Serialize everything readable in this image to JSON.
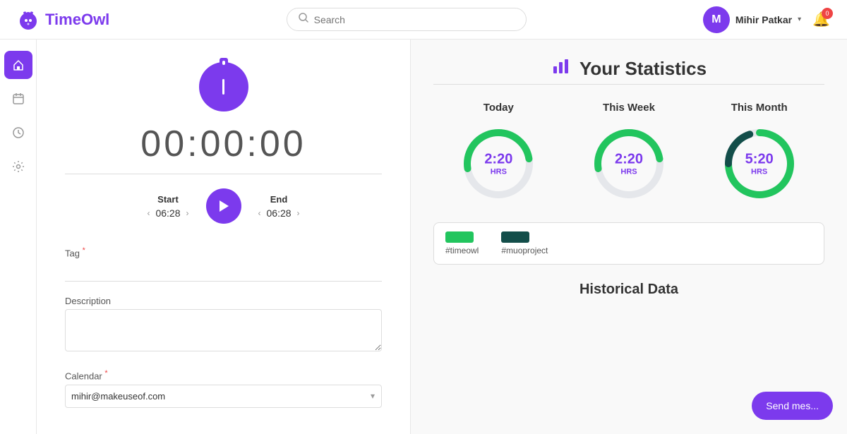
{
  "brand": {
    "name": "TimeOwl"
  },
  "navbar": {
    "search_placeholder": "Search",
    "user": {
      "initial": "M",
      "name": "Mihir Patkar"
    },
    "notification_count": "0"
  },
  "sidebar": {
    "items": [
      {
        "icon": "home",
        "label": "Home",
        "active": true
      },
      {
        "icon": "calendar",
        "label": "Calendar",
        "active": false
      },
      {
        "icon": "history",
        "label": "History",
        "active": false
      },
      {
        "icon": "settings",
        "label": "Settings",
        "active": false
      }
    ]
  },
  "timer": {
    "display": "00:00:00",
    "start_label": "Start",
    "start_time": "06:28",
    "end_label": "End",
    "end_time": "06:28"
  },
  "form": {
    "tag_label": "Tag",
    "tag_required": true,
    "description_label": "Description",
    "calendar_label": "Calendar",
    "calendar_required": true,
    "calendar_value": "mihir@makeuseof.com"
  },
  "statistics": {
    "title": "Your Statistics",
    "periods": [
      {
        "label": "Today",
        "time": "2:20",
        "unit": "HRS",
        "progress": 45
      },
      {
        "label": "This Week",
        "time": "2:20",
        "unit": "HRS",
        "progress": 45
      },
      {
        "label": "This Month",
        "time": "5:20",
        "unit": "HRS",
        "progress": 75
      }
    ],
    "legend": [
      {
        "color": "#22c55e",
        "label": "#timeowl"
      },
      {
        "color": "#134e4a",
        "label": "#muoproject"
      }
    ],
    "historical_title": "Historical Data"
  },
  "send_message": {
    "label": "Send mes..."
  }
}
